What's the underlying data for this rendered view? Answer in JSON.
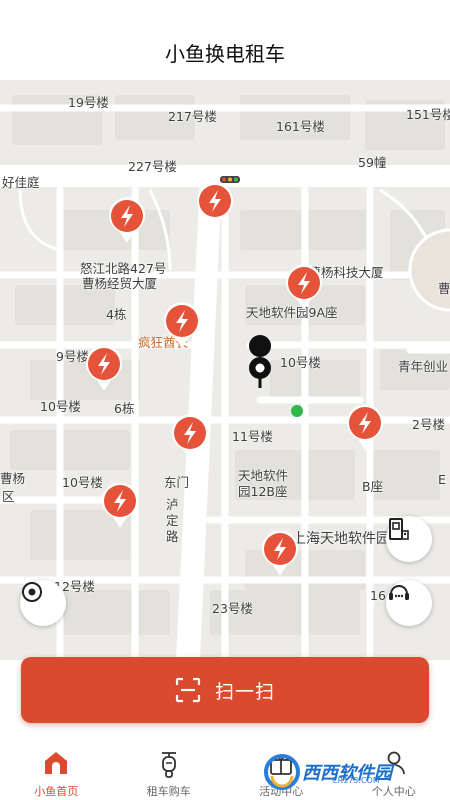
{
  "header": {
    "title": "小鱼换电租车"
  },
  "map": {
    "labels": [
      "19号楼",
      "217号楼",
      "161号楼",
      "151号楼",
      "227号楼",
      "59幢",
      "好佳庭",
      "怒江北路427号",
      "曹杨经贸大厦",
      "新曹杨科技大厦",
      "曹",
      "4栋",
      "天地软件园9A座",
      "疯狂酋长",
      "9号楼",
      "10号楼",
      "青年创业",
      "10号楼",
      "6栋",
      "2号楼",
      "11号楼",
      "东门",
      "天地软件",
      "园12B座",
      "B座",
      "E",
      "曹杨",
      "区",
      "10号楼",
      "泸",
      "定",
      "路",
      "上海天地软件园",
      "12号楼",
      "23号楼",
      "16"
    ]
  },
  "controls": {
    "locate_icon": "locate-target-icon",
    "building_icon": "building-icon",
    "service_icon": "customer-service-icon"
  },
  "scan": {
    "label": "扫一扫"
  },
  "tabs": [
    {
      "label": "小鱼首页",
      "icon": "home-icon",
      "active": true
    },
    {
      "label": "租车购车",
      "icon": "scooter-icon",
      "active": false
    },
    {
      "label": "活动中心",
      "icon": "gift-icon",
      "active": false
    },
    {
      "label": "个人中心",
      "icon": "person-icon",
      "active": false
    }
  ],
  "watermark": {
    "text": "西西软件园",
    "sub": "CR173.COM"
  },
  "colors": {
    "accent": "#d94a2f",
    "map_bg": "#ecebe7",
    "road": "#ffffff"
  }
}
